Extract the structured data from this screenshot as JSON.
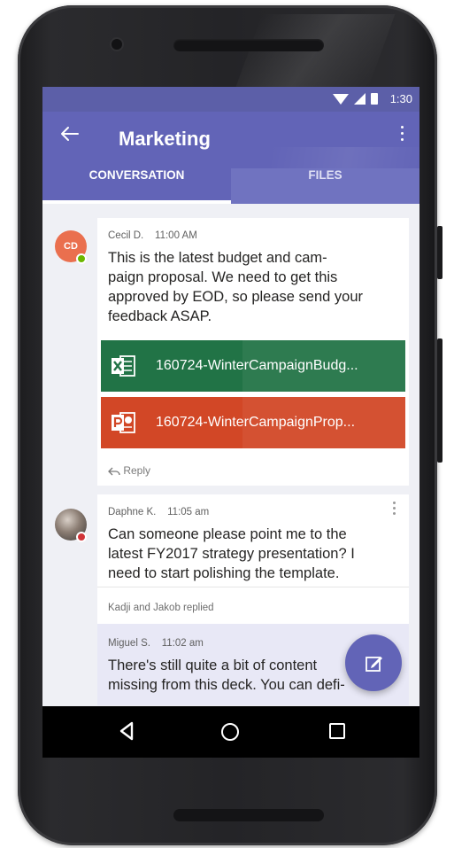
{
  "status_bar": {
    "time": "1:30"
  },
  "app_bar": {
    "title": "Marketing"
  },
  "tabs": [
    {
      "label": "CONVERSATION",
      "active": true
    },
    {
      "label": "FILES",
      "active": false
    }
  ],
  "messages": [
    {
      "avatar_initials": "CD",
      "author": "Cecil D.",
      "time": "11:00 AM",
      "text_lines": [
        "This is the latest budget and cam-",
        "paign proposal. We need to get this",
        "approved by EOD, so please send your",
        "feedback ASAP."
      ],
      "attachments": [
        {
          "type": "excel",
          "name": "160724-WinterCampaignBudg..."
        },
        {
          "type": "powerpoint",
          "name": "160724-WinterCampaignProp..."
        }
      ],
      "reply_label": "Reply"
    },
    {
      "author": "Daphne K.",
      "time": "11:05 am",
      "text_lines": [
        "Can someone please point me to the",
        "latest FY2017 strategy presentation? I",
        "need to start polishing the template."
      ],
      "replied_summary": "Kadji and Jakob replied",
      "nested_reply": {
        "author": "Miguel S.",
        "time": "11:02 am",
        "text_lines": [
          "There's still quite a bit of content",
          "missing from this deck. You can defi-"
        ]
      }
    }
  ],
  "colors": {
    "app_bar": "#6264b7",
    "status_bar": "#5c5fa8",
    "excel": "#217346",
    "powerpoint": "#d24726",
    "presence_online": "#6bb700",
    "presence_busy": "#d13438"
  },
  "icons": [
    "back-arrow-icon",
    "more-vertical-icon",
    "excel-icon",
    "powerpoint-icon",
    "reply-icon",
    "compose-icon",
    "nav-back-icon",
    "nav-home-icon",
    "nav-recents-icon"
  ]
}
